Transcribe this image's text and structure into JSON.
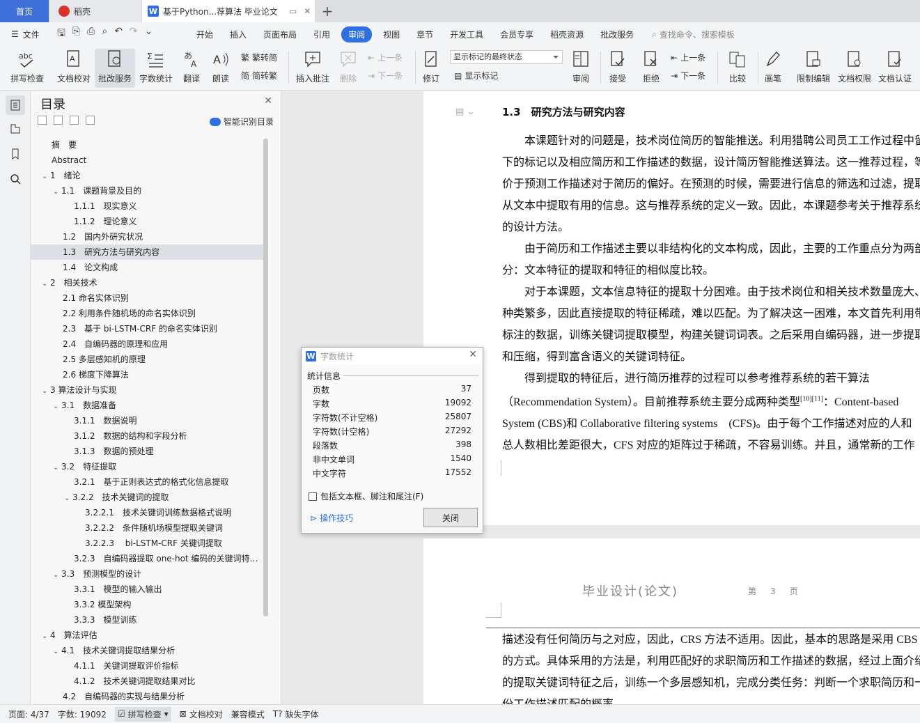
{
  "tabs": {
    "home": "首页",
    "dk": "稻壳",
    "doc": "基于Python...荐算法 毕业论文"
  },
  "menu": {
    "file": "文件",
    "tabs": [
      "开始",
      "插入",
      "页面布局",
      "引用",
      "审阅",
      "视图",
      "章节",
      "开发工具",
      "会员专享",
      "稻壳资源",
      "批改服务"
    ],
    "active_index": 4,
    "search": "查找命令、搜索模板"
  },
  "ribbon": {
    "spell": "拼写检查",
    "proof": "文档校对",
    "correct": "批改服务",
    "count": "字数统计",
    "translate": "翻译",
    "read": "朗读",
    "trad": "繁转简",
    "simp": "简转繁",
    "insert_comment": "插入批注",
    "delete": "删除",
    "prev1": "上一条",
    "next1": "下一条",
    "revise": "修订",
    "markup_select": "显示标记的最终状态",
    "show_markup": "显示标记",
    "review": "审阅",
    "accept": "接受",
    "reject": "拒绝",
    "prev2": "上一条",
    "next2": "下一条",
    "compare": "比较",
    "pen": "画笔",
    "restrict": "限制编辑",
    "perm": "文档权限",
    "auth": "文档认证"
  },
  "toc": {
    "title": "目录",
    "smart": "智能识别目录",
    "items": [
      {
        "t": "摘　要",
        "l": 0,
        "c": ""
      },
      {
        "t": "Abstract",
        "l": 0,
        "c": ""
      },
      {
        "t": "1　绪论",
        "l": 0,
        "c": "v"
      },
      {
        "t": "1.1　课题背景及目的",
        "l": 1,
        "c": "v"
      },
      {
        "t": "1.1.1　现实意义",
        "l": 2,
        "c": ""
      },
      {
        "t": "1.1.2　理论意义",
        "l": 2,
        "c": ""
      },
      {
        "t": "1.2　国内外研究状况",
        "l": 1,
        "c": ""
      },
      {
        "t": "1.3　研究方法与研究内容",
        "l": 1,
        "c": "",
        "sel": true
      },
      {
        "t": "1.4　论文构成",
        "l": 1,
        "c": ""
      },
      {
        "t": "2　相关技术",
        "l": 0,
        "c": "v"
      },
      {
        "t": "2.1 命名实体识别",
        "l": 1,
        "c": ""
      },
      {
        "t": "2.2 利用条件随机场的命名实体识别",
        "l": 1,
        "c": ""
      },
      {
        "t": "2.3　基于 bi-LSTM-CRF 的命名实体识别",
        "l": 1,
        "c": ""
      },
      {
        "t": "2.4　自编码器的原理和应用",
        "l": 1,
        "c": ""
      },
      {
        "t": "2.5 多层感知机的原理",
        "l": 1,
        "c": ""
      },
      {
        "t": "2.6 梯度下降算法",
        "l": 1,
        "c": ""
      },
      {
        "t": "3 算法设计与实现",
        "l": 0,
        "c": "v"
      },
      {
        "t": "3.1　数据准备",
        "l": 1,
        "c": "v"
      },
      {
        "t": "3.1.1　数据说明",
        "l": 2,
        "c": ""
      },
      {
        "t": "3.1.2　数据的结构和字段分析",
        "l": 2,
        "c": ""
      },
      {
        "t": "3.1.3　数据的预处理",
        "l": 2,
        "c": ""
      },
      {
        "t": "3.2　特征提取",
        "l": 1,
        "c": "v"
      },
      {
        "t": "3.2.1　基于正则表达式的格式化信息提取",
        "l": 2,
        "c": ""
      },
      {
        "t": "3.2.2　技术关键词的提取",
        "l": 2,
        "c": "v"
      },
      {
        "t": "3.2.2.1　技术关键词训练数据格式说明",
        "l": 3,
        "c": ""
      },
      {
        "t": "3.2.2.2　条件随机场模型提取关键词",
        "l": 3,
        "c": ""
      },
      {
        "t": "3.2.2.3　 bi-LSTM-CRF 关键词提取",
        "l": 3,
        "c": ""
      },
      {
        "t": "3.2.3　自编码器提取 one-hot 编码的关键词特…",
        "l": 2,
        "c": ""
      },
      {
        "t": "3.3　预测模型的设计",
        "l": 1,
        "c": "v"
      },
      {
        "t": "3.3.1　模型的输入输出",
        "l": 2,
        "c": ""
      },
      {
        "t": "3.3.2 模型架构",
        "l": 2,
        "c": ""
      },
      {
        "t": "3.3.3　模型训练",
        "l": 2,
        "c": ""
      },
      {
        "t": "4　算法评估",
        "l": 0,
        "c": "v"
      },
      {
        "t": "4.1　技术关键词提取结果分析",
        "l": 1,
        "c": "v"
      },
      {
        "t": "4.1.1　关键词提取评价指标",
        "l": 2,
        "c": ""
      },
      {
        "t": "4.1.2　技术关键词提取结果对比",
        "l": 2,
        "c": ""
      },
      {
        "t": "4.2　自编码器的实现与结果分析",
        "l": 1,
        "c": ""
      }
    ]
  },
  "doc": {
    "heading": "1.3　研究方法与研究内容",
    "lines": [
      "　　本课题针对的问题是，技术岗位简历的智能推送。利用猎聘公司员工工作过程中留",
      "下的标记以及相应简历和工作描述的数据，设计简历智能推送算法。这一推荐过程，等",
      "价于预测工作描述对于简历的偏好。在预测的时候，需要进行信息的筛选和过滤，提取",
      "从文本中提取有用的信息。这与推荐系统的定义一致。因此，本课题参考关于推荐系统",
      "的设计方法。",
      "　　由于简历和工作描述主要以非结构化的文本构成，因此，主要的工作重点分为两部",
      "分：文本特征的提取和特征的相似度比较。",
      "　　对于本课题，文本信息特征的提取十分困难。由于技术岗位和相关技术数量庞大、",
      "种类繁多，因此直接提取的特征稀疏，难以匹配。为了解决这一困难，本文首先利用带",
      "标注的数据，训练关键词提取模型，构建关键词词表。之后采用自编码器，进一步提取",
      "和压缩，得到富含语义的关键词特征。",
      "　　得到提取的特征后，进行简历推荐的过程可以参考推荐系统的若干算法"
    ],
    "line13a": "（Recommendation System）。目前推荐系统主要分成两种类型",
    "ref": "[10][11]",
    "line13b": "：Content-based",
    "line14": "System (CBS)和 Collaborative filtering systems　(CFS)。由于每个工作描述对应的人和",
    "line15": "总人数相比差距很大，CFS 对应的矩阵过于稀疏，不容易训练。并且，通常新的工作",
    "page2_header": "毕业设计(论文)",
    "page2_pageno": "第　3　页",
    "page2_lines": [
      "描述没有任何简历与之对应，因此，CRS 方法不适用。因此，基本的思路是采用 CBS",
      "的方式。具体采用的方法是，利用匹配好的求职简历和工作描述的数据，经过上面介绍",
      "的提取关键词特征之后，训练一个多层感知机，完成分类任务：判断一个求职简历和一",
      "份工作描述匹配的概率。"
    ]
  },
  "dialog": {
    "title": "字数统计",
    "section": "统计信息",
    "rows": [
      {
        "k": "页数",
        "v": "37"
      },
      {
        "k": "字数",
        "v": "19092"
      },
      {
        "k": "字符数(不计空格)",
        "v": "25807"
      },
      {
        "k": "字符数(计空格)",
        "v": "27292"
      },
      {
        "k": "段落数",
        "v": "398"
      },
      {
        "k": "非中文单词",
        "v": "1540"
      },
      {
        "k": "中文字符",
        "v": "17552"
      }
    ],
    "checkbox": "包括文本框、脚注和尾注(F)",
    "tips": "操作技巧",
    "close": "关闭"
  },
  "status": {
    "page": "页面: 4/37",
    "words": "字数: 19092",
    "spell": "拼写检查",
    "proof": "文档校对",
    "compat": "兼容模式",
    "font": "缺失字体"
  }
}
